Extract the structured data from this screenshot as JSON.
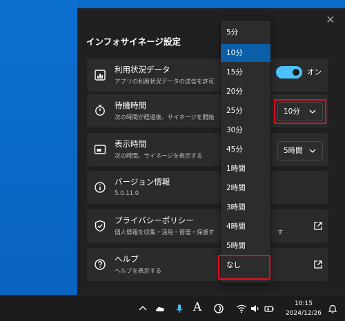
{
  "panel": {
    "title": "インフォサイネージ設定",
    "close_glyph": "✕"
  },
  "settings": {
    "usage": {
      "title": "利用状況データ",
      "desc": "アプリの利用状況データの送信を許可",
      "toggle_state": "オン"
    },
    "standby": {
      "title": "待機時間",
      "desc": "次の時間が経過後、サイネージを開始",
      "value": "10分"
    },
    "display": {
      "title": "表示時間",
      "desc": "次の時間、サイネージを表示する",
      "value": "5時間"
    },
    "version": {
      "title": "バージョン情報",
      "desc": "5.0.11.0"
    },
    "privacy": {
      "title": "プライバシーポリシー",
      "desc": "個人情報を収集・活用・管理・保護す",
      "desc_tail": "す"
    },
    "help": {
      "title": "ヘルプ",
      "desc": "ヘルプを表示する"
    }
  },
  "dropdown": {
    "options": [
      "5分",
      "10分",
      "15分",
      "20分",
      "25分",
      "30分",
      "45分",
      "1時間",
      "2時間",
      "3時間",
      "4時間",
      "5時間",
      "なし"
    ],
    "selected": "10分"
  },
  "taskbar": {
    "time": "10:15",
    "date": "2024/12/26",
    "ime_label": "A"
  },
  "colors": {
    "accent": "#4cc2ff",
    "selected_item": "#0a5fa8",
    "highlight": "#e01020",
    "panel_bg": "#202020",
    "card_bg": "#2b2b2b"
  },
  "icons": {
    "usage": "bar-chart-icon",
    "standby": "stopwatch-icon",
    "display": "picture-in-picture-icon",
    "version": "info-icon",
    "privacy": "shield-check-icon",
    "help": "question-icon"
  }
}
